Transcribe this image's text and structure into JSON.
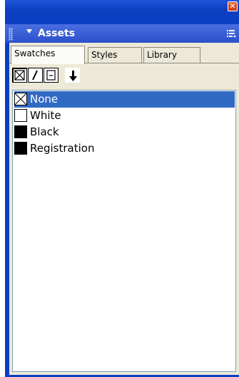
{
  "window": {
    "close_glyph": "✕"
  },
  "palette": {
    "title": "Assets",
    "menu_icon": "palette-menu-icon"
  },
  "tabs": [
    {
      "label": "Swatches",
      "active": true
    },
    {
      "label": "Styles",
      "active": false
    },
    {
      "label": "Library",
      "active": false
    }
  ],
  "toolbar": {
    "buttons": [
      "fill-none-icon",
      "stroke-icon",
      "fill-box-icon",
      "apply-arrow-icon"
    ]
  },
  "swatches": [
    {
      "name": "None",
      "color": "none",
      "selected": true
    },
    {
      "name": "White",
      "color": "#ffffff",
      "selected": false
    },
    {
      "name": "Black",
      "color": "#000000",
      "selected": false
    },
    {
      "name": "Registration",
      "color": "#000000",
      "selected": false
    }
  ],
  "colors": {
    "title_bar": "#0a3fc2",
    "header": "#2a50cc",
    "selection": "#316ac5",
    "panel_bg": "#ece9d8"
  }
}
